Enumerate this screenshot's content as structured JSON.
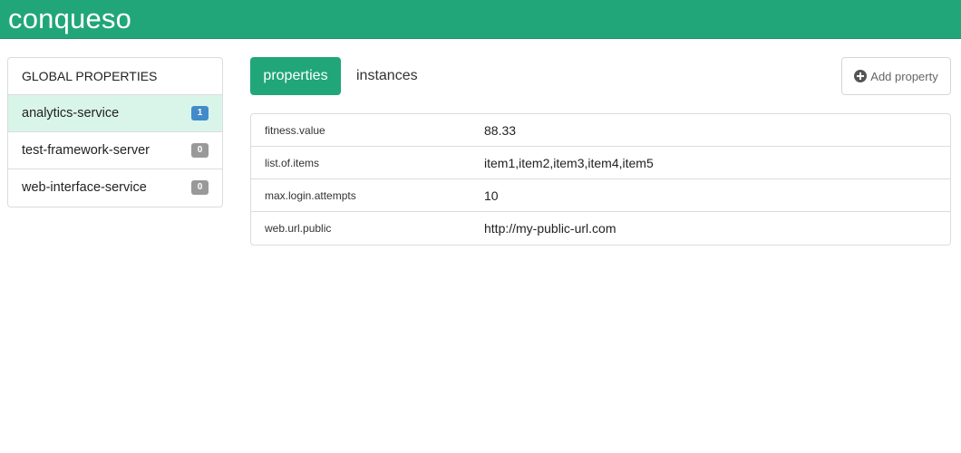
{
  "app": {
    "title": "conqueso"
  },
  "sidebar": {
    "heading": "GLOBAL PROPERTIES",
    "items": [
      {
        "label": "analytics-service",
        "count": "1",
        "active": true
      },
      {
        "label": "test-framework-server",
        "count": "0",
        "active": false
      },
      {
        "label": "web-interface-service",
        "count": "0",
        "active": false
      }
    ]
  },
  "tabs": [
    {
      "label": "properties",
      "active": true
    },
    {
      "label": "instances",
      "active": false
    }
  ],
  "toolbar": {
    "add_property_label": "Add property",
    "add_property_icon": "plus-circle-icon"
  },
  "properties": [
    {
      "key": "fitness.value",
      "value": "88.33"
    },
    {
      "key": "list.of.items",
      "value": "item1,item2,item3,item4,item5"
    },
    {
      "key": "max.login.attempts",
      "value": "10"
    },
    {
      "key": "web.url.public",
      "value": "http://my-public-url.com"
    }
  ],
  "colors": {
    "brand": "#21a67a",
    "active_item_bg": "#d9f5ea",
    "badge_active": "#428bca",
    "badge_inactive": "#999999"
  }
}
